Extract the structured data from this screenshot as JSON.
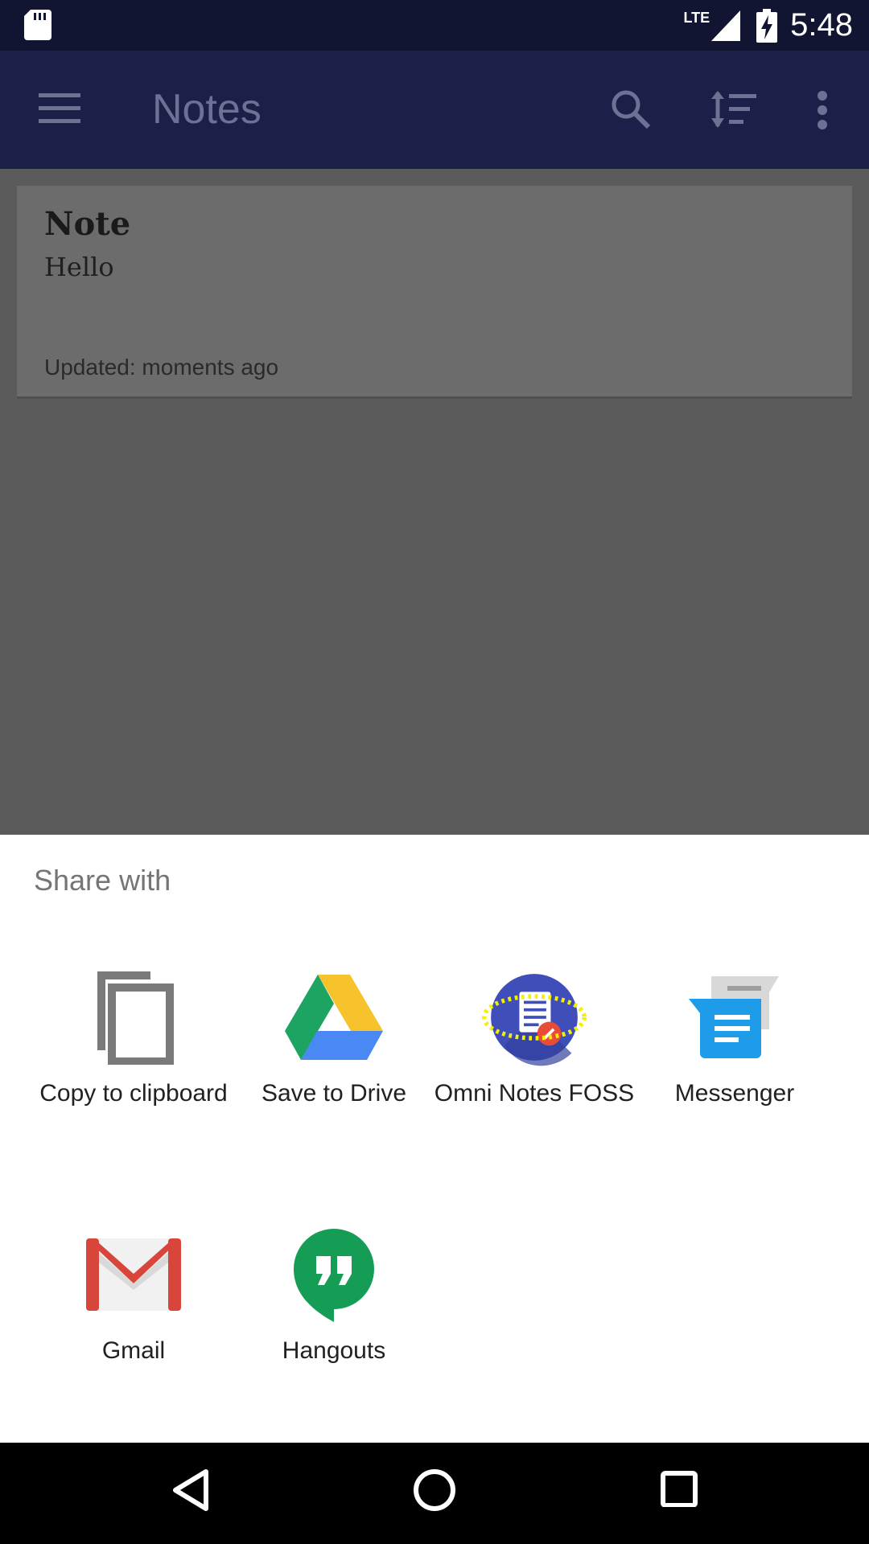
{
  "status_bar": {
    "network": "LTE",
    "time": "5:48"
  },
  "app_bar": {
    "title": "Notes",
    "icons": [
      "menu-icon",
      "search-icon",
      "sort-icon",
      "more-vert-icon"
    ]
  },
  "note": {
    "title": "Note",
    "body": "Hello",
    "updated": "Updated: moments ago"
  },
  "share_sheet": {
    "heading": "Share with",
    "apps": [
      {
        "label": "Copy to clipboard",
        "icon": "clipboard-icon"
      },
      {
        "label": "Save to Drive",
        "icon": "drive-icon"
      },
      {
        "label": "Omni Notes FOSS",
        "icon": "omni-notes-icon"
      },
      {
        "label": "Messenger",
        "icon": "messenger-icon"
      },
      {
        "label": "Gmail",
        "icon": "gmail-icon"
      },
      {
        "label": "Hangouts",
        "icon": "hangouts-icon"
      }
    ]
  },
  "nav_bar": {
    "icons": [
      "back-icon",
      "home-icon",
      "recents-icon"
    ]
  },
  "colors": {
    "status_bar": "#111531",
    "app_bar": "#1b2049",
    "scrim": "#5b5b5b",
    "sheet": "#ffffff"
  }
}
